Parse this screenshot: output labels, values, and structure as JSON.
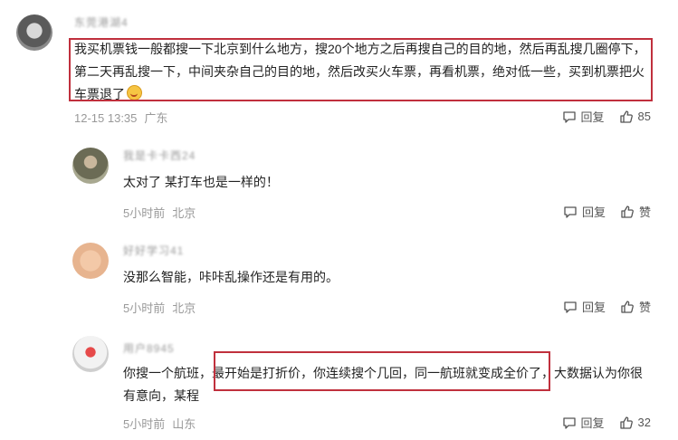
{
  "main_comment": {
    "username": "东莞港湖4",
    "text": "我买机票钱一般都搜一下北京到什么地方，搜20个地方之后再搜自己的目的地，然后再乱搜几圈停下，第二天再乱搜一下，中间夹杂自己的目的地，然后改买火车票，再看机票，绝对低一些，买到机票把火车票退了",
    "time": "12-15 13:35",
    "location": "广东",
    "reply_label": "回复",
    "like_count": "85"
  },
  "replies": [
    {
      "username": "我是卡卡西24",
      "text": "太对了 某打车也是一样的！",
      "time": "5小时前",
      "location": "北京",
      "reply_label": "回复",
      "like_label": "赞"
    },
    {
      "username": "好好学习41",
      "text": "没那么智能，咔咔乱操作还是有用的。",
      "time": "5小时前",
      "location": "北京",
      "reply_label": "回复",
      "like_label": "赞"
    },
    {
      "username": "用户8945",
      "text_before": "你搜一个航班，",
      "text_highlight": "最开始是打折价，你连续搜个几回，同一航班就变成全价了",
      "text_after": "，大数据认为你很有意向，某程",
      "time": "5小时前",
      "location": "山东",
      "reply_label": "回复",
      "like_count": "32"
    }
  ],
  "colors": {
    "highlight_border": "#c0303d",
    "meta_text": "#999999"
  },
  "icons": {
    "reply": "comment-bubble-icon",
    "like": "thumbs-up-icon",
    "emoji": "grinning-face-icon"
  }
}
